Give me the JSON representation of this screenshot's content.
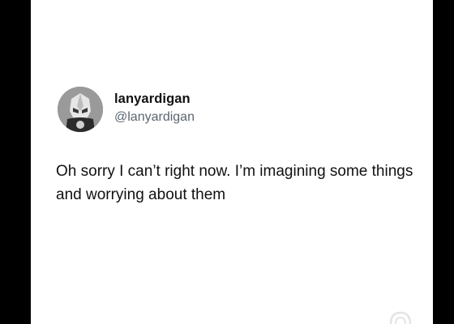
{
  "post": {
    "author": {
      "display_name": "lanyardigan",
      "handle": "@lanyardigan",
      "avatar_icon": "helmet-avatar-icon"
    },
    "text": "Oh sorry I can’t right now. I’m imagining some things and worrying about them"
  },
  "colors": {
    "background": "#000000",
    "card": "#ffffff",
    "text": "#111111",
    "handle": "#5b6570"
  }
}
